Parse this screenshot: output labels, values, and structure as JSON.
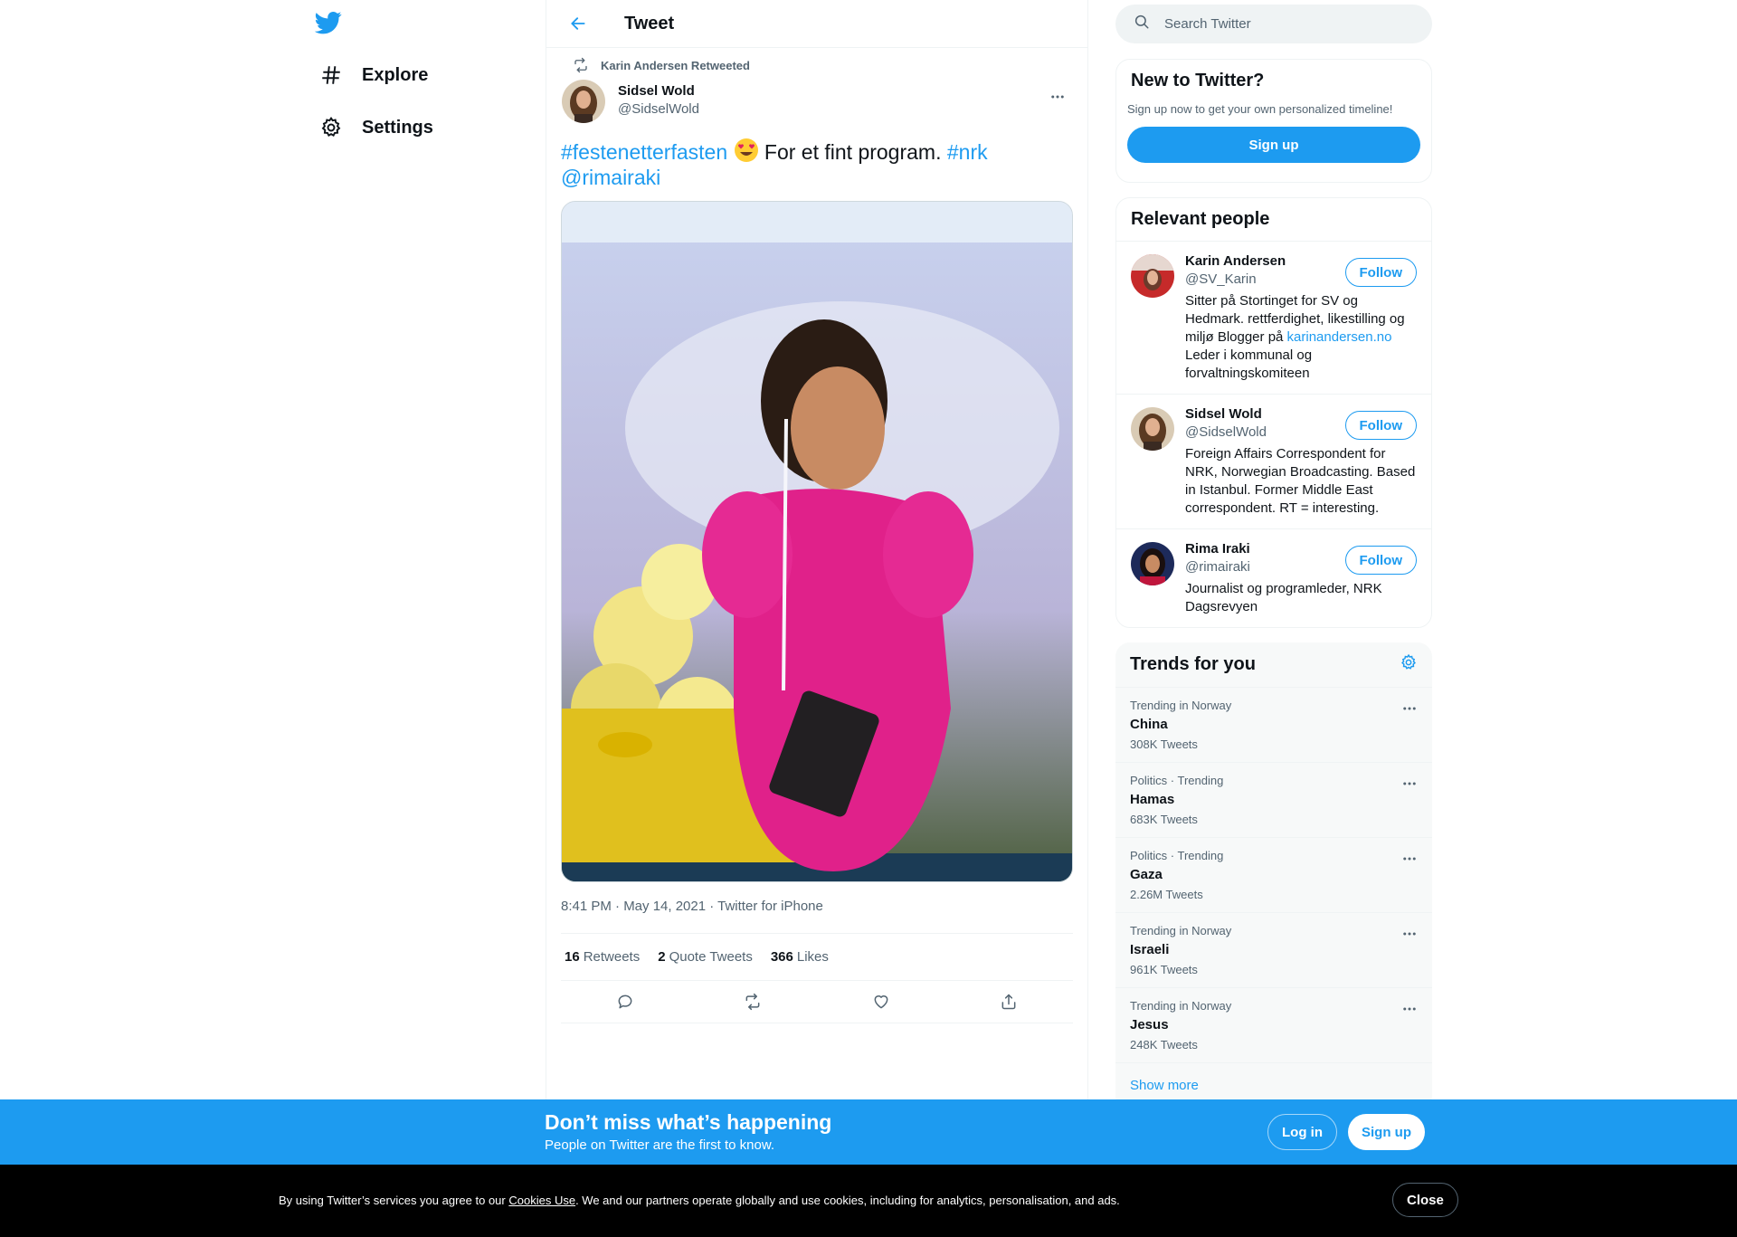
{
  "colors": {
    "accent": "#1d9bf0",
    "text": "#0f1419",
    "secondary": "#536471",
    "border": "#eff3f4"
  },
  "nav": {
    "items": [
      {
        "label": "Explore",
        "icon": "hashtag-icon"
      },
      {
        "label": "Settings",
        "icon": "gear-icon"
      }
    ]
  },
  "header": {
    "title": "Tweet"
  },
  "tweet": {
    "retweeted_by": "Karin Andersen Retweeted",
    "author_name": "Sidsel Wold",
    "author_handle": "@SidselWold",
    "text_parts": {
      "hashtag1": "#festenetterfasten",
      "body": " For et fint program. ",
      "hashtag2": "#nrk",
      "mention": "@rimairaki"
    },
    "timestamp": "8:41 PM · May 14, 2021 · Twitter for iPhone",
    "stats": {
      "retweets_count": "16",
      "retweets_label": "Retweets",
      "quotes_count": "2",
      "quotes_label": "Quote Tweets",
      "likes_count": "366",
      "likes_label": "Likes"
    }
  },
  "search": {
    "placeholder": "Search Twitter"
  },
  "new_to_twitter": {
    "title": "New to Twitter?",
    "subtitle": "Sign up now to get your own personalized timeline!",
    "signup_label": "Sign up"
  },
  "relevant_people": {
    "title": "Relevant people",
    "follow_label": "Follow",
    "people": [
      {
        "name": "Karin Andersen",
        "handle": "@SV_Karin",
        "bio_pre": "Sitter på Stortinget for SV og Hedmark. rettferdighet, likestilling og miljø Blogger på ",
        "bio_link": "karinandersen.no",
        "bio_post": " Leder i kommunal og forvaltningskomiteen"
      },
      {
        "name": "Sidsel Wold",
        "handle": "@SidselWold",
        "bio_pre": "Foreign Affairs Correspondent for NRK, Norwegian Broadcasting. Based in Istanbul. Former Middle East correspondent. RT = interesting.",
        "bio_link": "",
        "bio_post": ""
      },
      {
        "name": "Rima Iraki",
        "handle": "@rimairaki",
        "bio_pre": "Journalist og programleder, NRK Dagsrevyen",
        "bio_link": "",
        "bio_post": ""
      }
    ]
  },
  "trends": {
    "title": "Trends for you",
    "items": [
      {
        "context": "Trending in Norway",
        "name": "China",
        "count": "308K Tweets"
      },
      {
        "context": "Politics · Trending",
        "name": "Hamas",
        "count": "683K Tweets"
      },
      {
        "context": "Politics · Trending",
        "name": "Gaza",
        "count": "2.26M Tweets"
      },
      {
        "context": "Trending in Norway",
        "name": "Israeli",
        "count": "961K Tweets"
      },
      {
        "context": "Trending in Norway",
        "name": "Jesus",
        "count": "248K Tweets"
      }
    ],
    "show_more": "Show more"
  },
  "banner": {
    "title": "Don’t miss what’s happening",
    "subtitle": "People on Twitter are the first to know.",
    "login_label": "Log in",
    "signup_label": "Sign up"
  },
  "cookie": {
    "pre": "By using Twitter’s services you agree to our ",
    "link": "Cookies Use",
    "post": ". We and our partners operate globally and use cookies, including for analytics, personalisation, and ads.",
    "close_label": "Close"
  }
}
